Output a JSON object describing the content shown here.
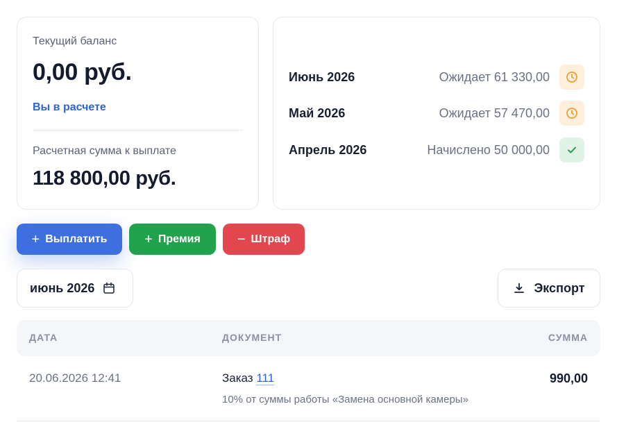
{
  "balance": {
    "current_label": "Текущий баланс",
    "current_amount": "0,00 руб.",
    "status": "Вы в расчете",
    "payout_label": "Расчетная сумма к выплате",
    "payout_amount": "118 800,00 руб."
  },
  "months": [
    {
      "name": "Июнь 2026",
      "status": "Ожидает 61 330,00",
      "icon": "clock-icon",
      "state": "pending"
    },
    {
      "name": "Май 2026",
      "status": "Ожидает 57 470,00",
      "icon": "clock-icon",
      "state": "pending"
    },
    {
      "name": "Апрель 2026",
      "status": "Начислено 50 000,00",
      "icon": "check-icon",
      "state": "done"
    }
  ],
  "actions": {
    "pay_label": "Выплатить",
    "bonus_label": "Премия",
    "fine_label": "Штраф",
    "plus_sign": "+",
    "minus_sign": "−"
  },
  "filters": {
    "period": "июнь 2026",
    "export_label": "Экспорт"
  },
  "table": {
    "headers": {
      "date": "ДАТА",
      "document": "ДОКУМЕНТ",
      "amount": "СУММА"
    },
    "rows": [
      {
        "date": "20.06.2026 12:41",
        "doc_prefix": "Заказ",
        "doc_number": "111",
        "description": "10% от суммы работы «Замена основной камеры»",
        "amount": "990,00"
      }
    ]
  },
  "colors": {
    "primary": "#3d6fe0",
    "success": "#23a24d",
    "danger": "#e2474f",
    "pending_icon": "#e8a13a",
    "done_icon": "#2f9d55"
  }
}
